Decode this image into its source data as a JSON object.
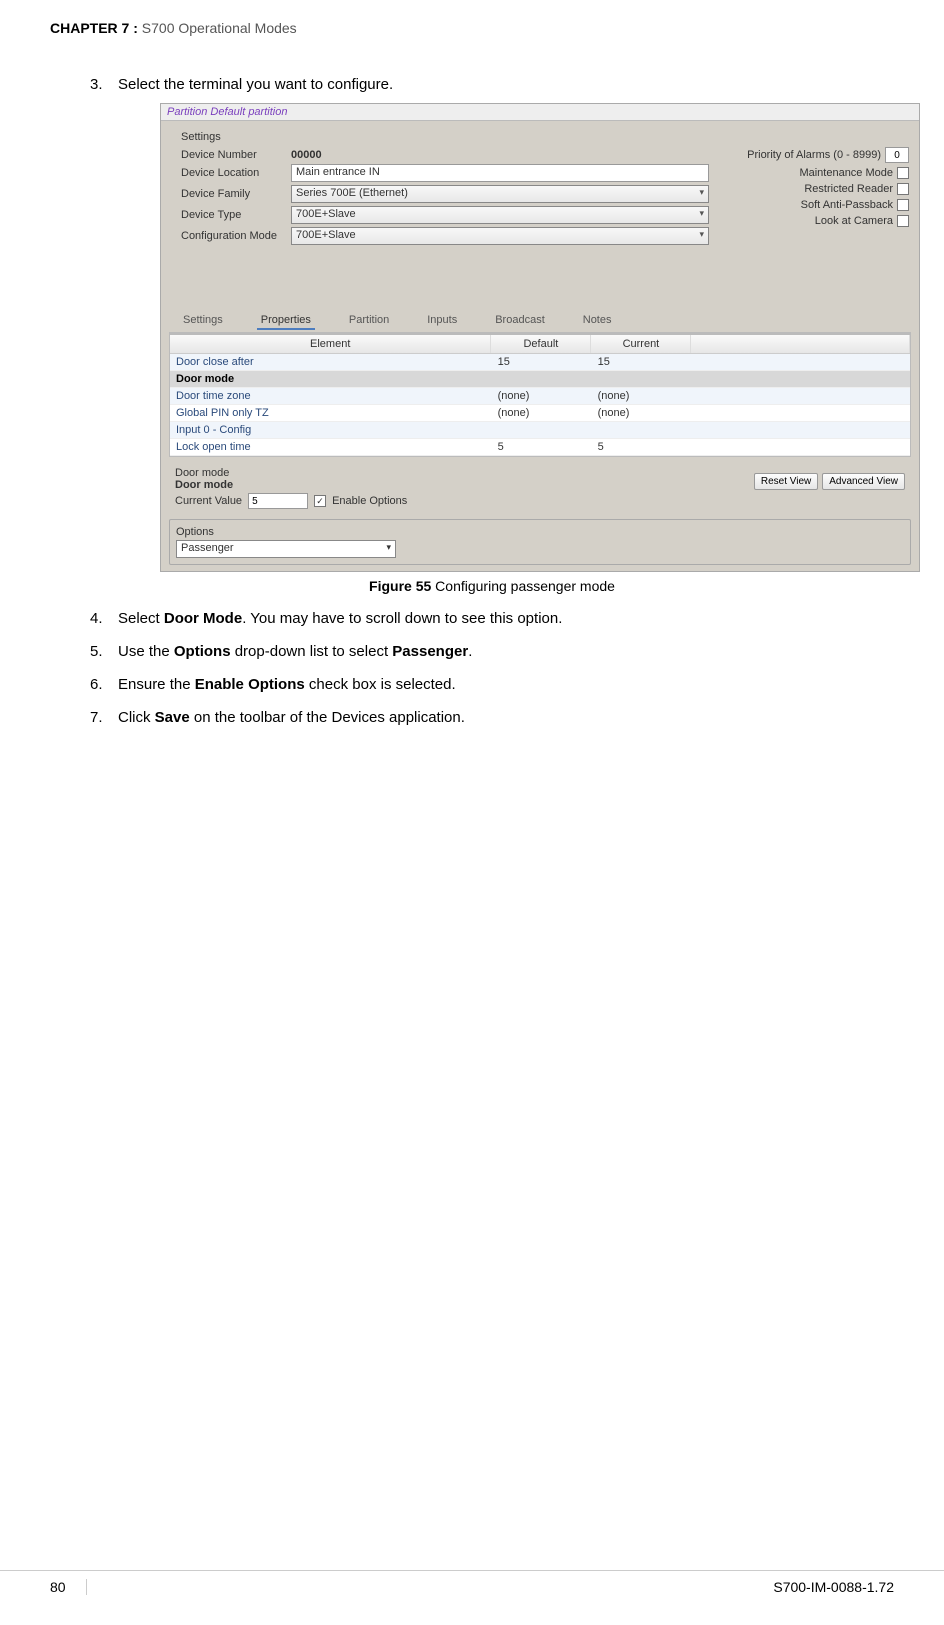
{
  "header": {
    "chapter_num": "CHAPTER  7 :",
    "chapter_title": " S700 Operational Modes"
  },
  "steps": {
    "s3": {
      "n": "3.",
      "t": "Select the terminal you want to configure."
    },
    "s4": {
      "n": "4.",
      "pre": "Select ",
      "b": "Door Mode",
      "post": ". You may have to scroll down to see this option."
    },
    "s5": {
      "n": "5.",
      "pre": "Use the ",
      "b1": "Options",
      "mid": " drop-down list to select ",
      "b2": "Passenger",
      "post": "."
    },
    "s6": {
      "n": "6.",
      "pre": "Ensure the ",
      "b": "Enable Options",
      "post": " check box is selected."
    },
    "s7": {
      "n": "7.",
      "pre": "Click ",
      "b": "Save",
      "post": " on the toolbar of the Devices application."
    }
  },
  "figure": {
    "num": "Figure 55",
    "caption": " Configuring passenger mode"
  },
  "sc": {
    "titlebar": "Partition   Default partition",
    "section": "Settings",
    "rows": {
      "devnum": {
        "lbl": "Device Number",
        "val": "00000"
      },
      "devloc": {
        "lbl": "Device Location",
        "val": "Main entrance IN"
      },
      "devfam": {
        "lbl": "Device Family",
        "val": "Series 700E (Ethernet)"
      },
      "devtype": {
        "lbl": "Device Type",
        "val": "700E+Slave"
      },
      "confmode": {
        "lbl": "Configuration Mode",
        "val": "700E+Slave"
      }
    },
    "right": {
      "priority": {
        "lbl": "Priority of Alarms (0 - 8999)",
        "val": "0"
      },
      "maint": "Maintenance Mode",
      "restr": "Restricted Reader",
      "soft": "Soft Anti-Passback",
      "look": "Look at Camera"
    },
    "tabs": {
      "t1": "Settings",
      "t2": "Properties",
      "t3": "Partition",
      "t4": "Inputs",
      "t5": "Broadcast",
      "t6": "Notes"
    },
    "grid": {
      "h_el": "Element",
      "h_def": "Default",
      "h_cur": "Current",
      "r1": {
        "el": "Door close after",
        "def": "15",
        "cur": "15"
      },
      "r2": {
        "el": "Door mode",
        "def": "",
        "cur": ""
      },
      "r3": {
        "el": "Door time zone",
        "def": "(none)",
        "cur": "(none)"
      },
      "r4": {
        "el": "Global PIN only TZ",
        "def": "(none)",
        "cur": "(none)"
      },
      "r5": {
        "el": "Input 0 - Config",
        "def": "",
        "cur": ""
      },
      "r6": {
        "el": "Lock open time",
        "def": "5",
        "cur": "5"
      }
    },
    "detail": {
      "t1": "Door mode",
      "t2": "Door mode",
      "cv_lbl": "Current Value",
      "cv_val": "5",
      "eo": "Enable Options",
      "btn1": "Reset View",
      "btn2": "Advanced View"
    },
    "options": {
      "lbl": "Options",
      "val": "Passenger"
    }
  },
  "footer": {
    "page": "80",
    "doc": "S700-IM-0088-1.72"
  }
}
